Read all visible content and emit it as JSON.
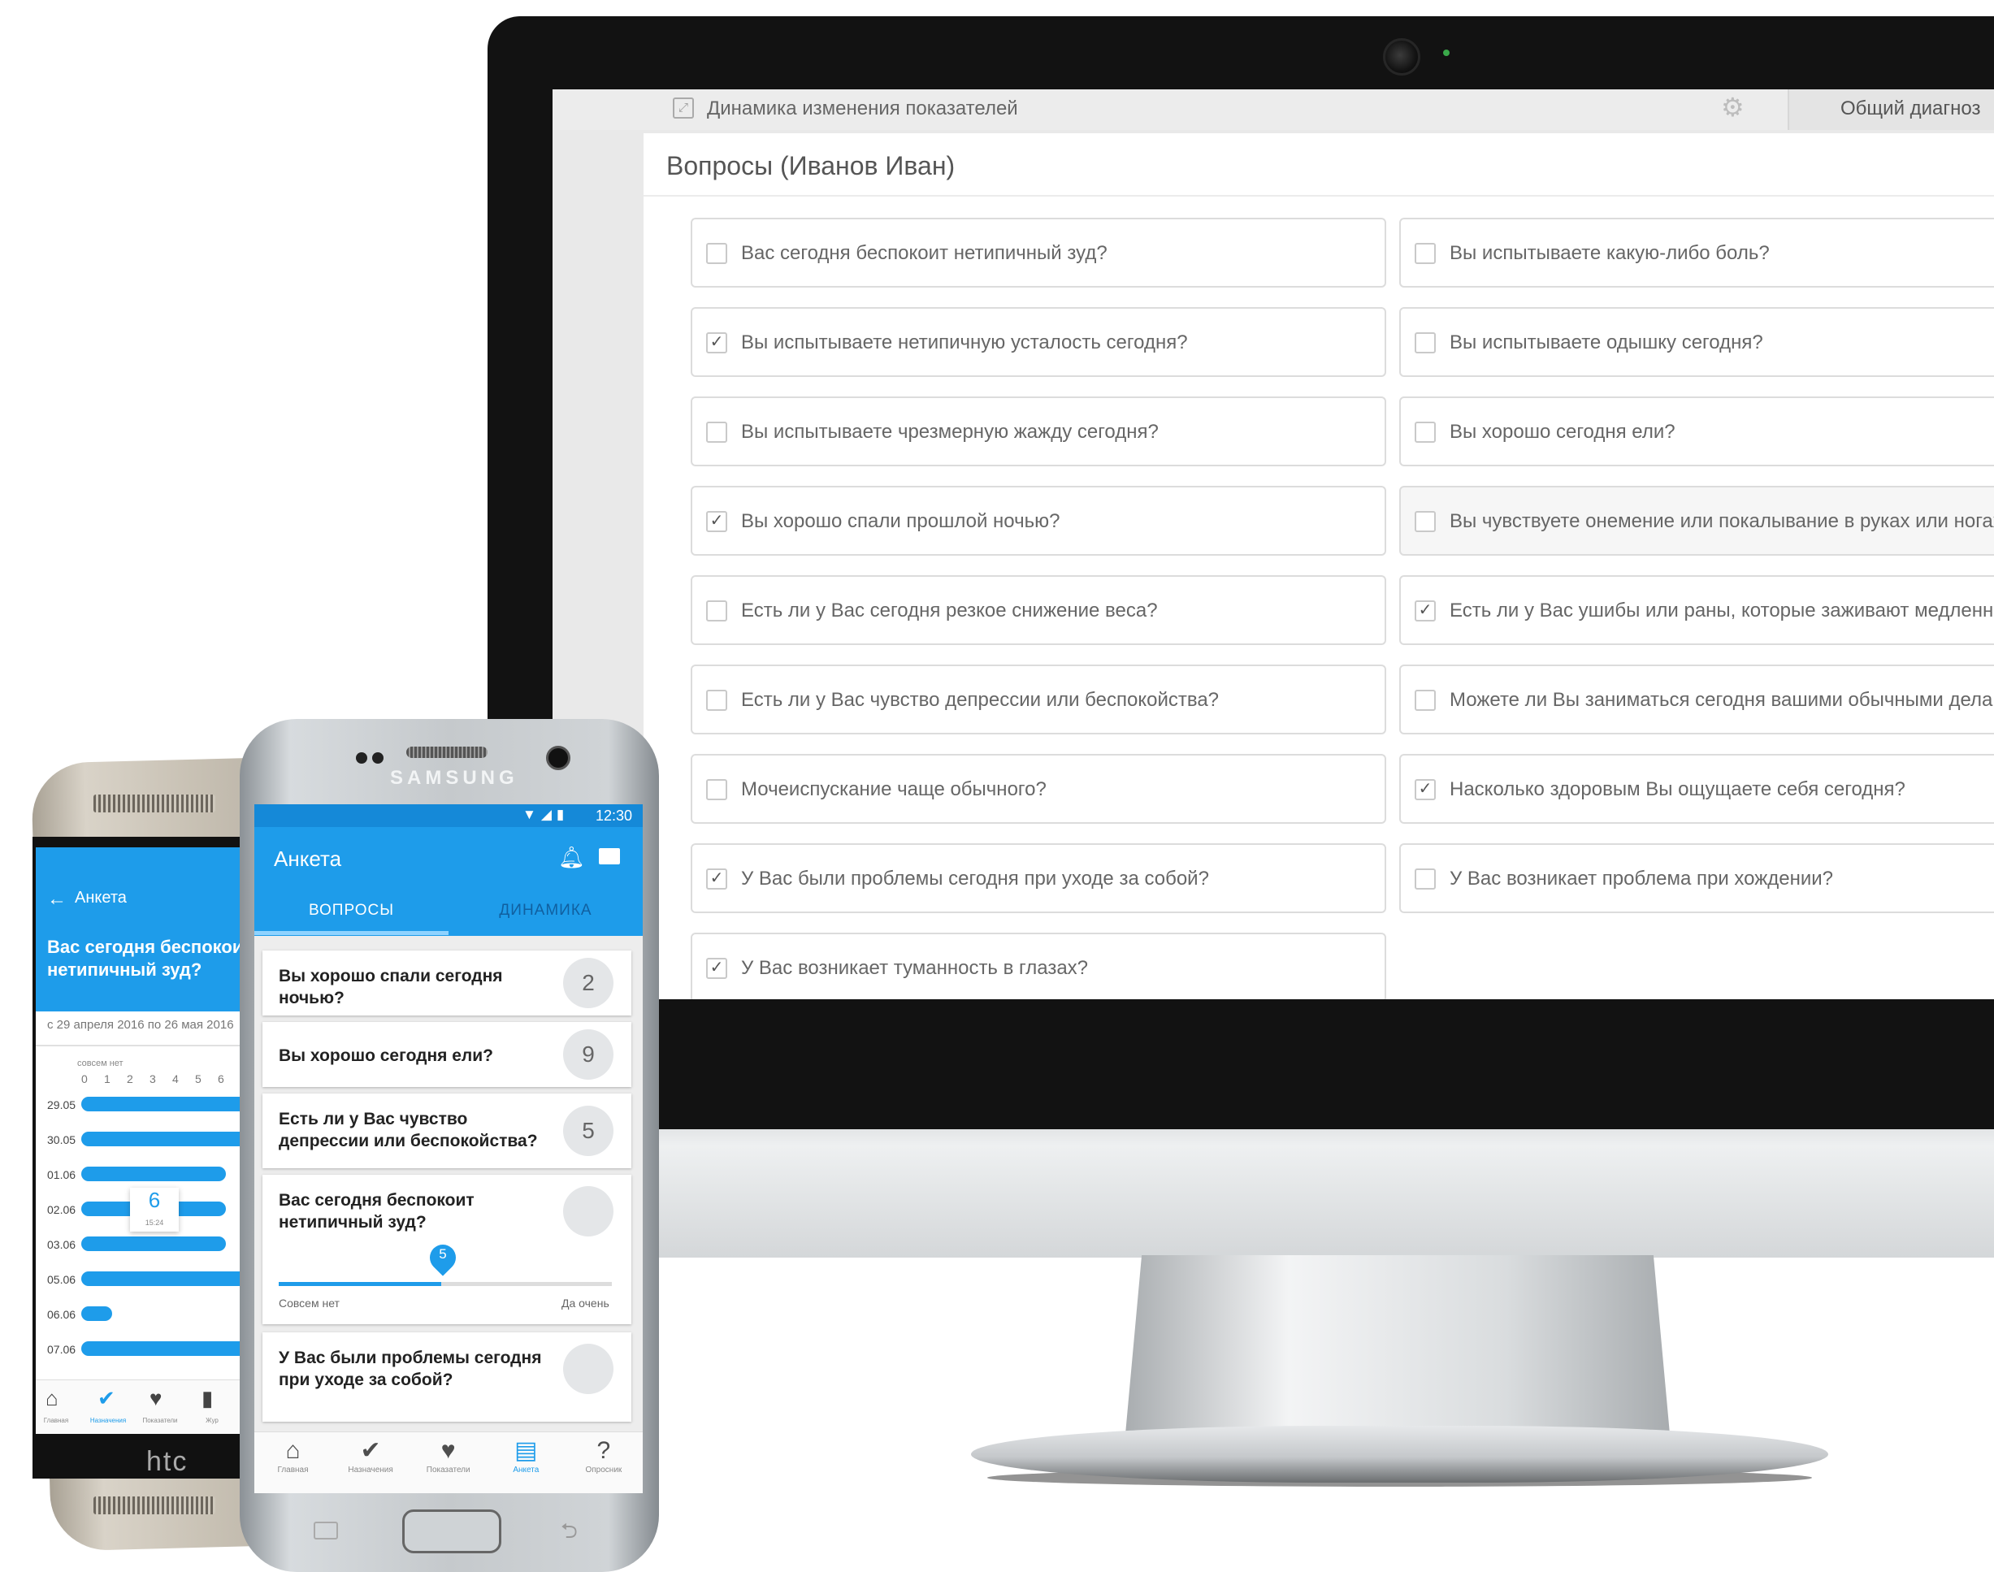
{
  "desktop": {
    "topbar_title": "Динамика изменения показателей",
    "right_tab": "Общий диагноз",
    "panel_title": "Вопросы (Иванов Иван)",
    "questions_left": [
      {
        "text": "Вас сегодня беспокоит нетипичный зуд?",
        "checked": false
      },
      {
        "text": "Вы испытываете нетипичную усталость сегодня?",
        "checked": true
      },
      {
        "text": "Вы испытываете чрезмерную жажду сегодня?",
        "checked": false
      },
      {
        "text": "Вы хорошо спали прошлой ночью?",
        "checked": true
      },
      {
        "text": "Есть ли у Вас сегодня резкое снижение веса?",
        "checked": false
      },
      {
        "text": "Есть ли у Вас чувство депрессии или беспокойства?",
        "checked": false
      },
      {
        "text": "Мочеиспускание чаще обычного?",
        "checked": false
      },
      {
        "text": "У Вас были проблемы сегодня при уходе за собой?",
        "checked": true
      },
      {
        "text": "У Вас возникает туманность в глазах?",
        "checked": true
      }
    ],
    "questions_right": [
      {
        "text": "Вы испытываете какую-либо боль?",
        "checked": false
      },
      {
        "text": "Вы испытываете одышку сегодня?",
        "checked": false
      },
      {
        "text": "Вы хорошо сегодня ели?",
        "checked": false
      },
      {
        "text": "Вы чувствуете онемение или покалывание в руках или ногах?",
        "checked": false
      },
      {
        "text": "Есть ли у Вас ушибы или раны, которые заживают медленно?",
        "checked": true
      },
      {
        "text": "Можете ли Вы заниматься сегодня вашими обычными делами?",
        "checked": false
      },
      {
        "text": "Насколько здоровым Вы ощущаете себя сегодня?",
        "checked": true
      },
      {
        "text": "У Вас возникает проблема при хождении?",
        "checked": false
      }
    ]
  },
  "htc": {
    "title": "Анкета",
    "question": "Вас сегодня беспокоит нетипичный зуд?",
    "date_range": "с 29 апреля 2016 по 26 мая 2016",
    "scale_label": "совсем нет",
    "ticks": [
      "0",
      "1",
      "2",
      "3",
      "4",
      "5",
      "6"
    ],
    "rows": [
      {
        "date": "29.05",
        "value": 7
      },
      {
        "date": "30.05",
        "value": 7
      },
      {
        "date": "01.06",
        "value": 6
      },
      {
        "date": "02.06",
        "value": 6
      },
      {
        "date": "03.06",
        "value": 6
      },
      {
        "date": "05.06",
        "value": 7
      },
      {
        "date": "06.06",
        "value": 1
      },
      {
        "date": "07.06",
        "value": 7
      }
    ],
    "tooltip_value": "6",
    "tooltip_time": "15:24",
    "nav": [
      "Главная",
      "Назначения",
      "Показатели",
      "Жур"
    ],
    "brand": "htc"
  },
  "samsung": {
    "brand": "SAMSUNG",
    "status_time": "12:30",
    "title": "Анкета",
    "tab_questions": "ВОПРОСЫ",
    "tab_dynamics": "ДИНАМИКА",
    "cards": [
      {
        "text": "Вы хорошо спали сегодня ночью?",
        "value": "2"
      },
      {
        "text": "Вы хорошо сегодня ели?",
        "value": "9"
      },
      {
        "text": "Есть ли у Вас чувство депрессии или беспокойства?",
        "value": "5"
      },
      {
        "text": "Вас сегодня беспокоит нетипичный зуд?",
        "value": ""
      },
      {
        "text": "У Вас были проблемы сегодня при уходе за собой?",
        "value": ""
      }
    ],
    "slider": {
      "value": "5",
      "min_label": "Совсем нет",
      "max_label": "Да очень",
      "fraction": 0.5
    },
    "nav": [
      {
        "label": "Главная",
        "icon": "home-icon"
      },
      {
        "label": "Назначения",
        "icon": "check-circle-icon"
      },
      {
        "label": "Показатели",
        "icon": "heart-icon"
      },
      {
        "label": "Анкета",
        "icon": "form-icon"
      },
      {
        "label": "Опросник",
        "icon": "help-icon"
      }
    ],
    "accent": "#1e9cea"
  }
}
